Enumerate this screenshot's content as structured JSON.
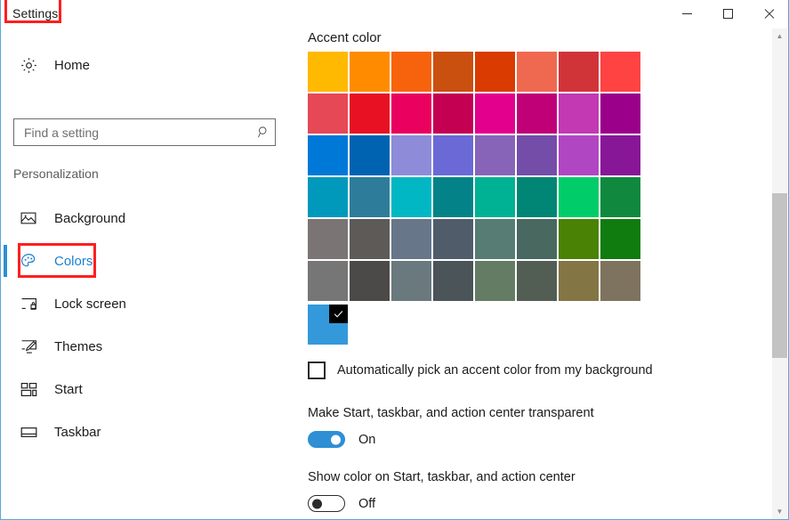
{
  "window": {
    "title": "Settings",
    "controls": {
      "minimize": "minimize-icon",
      "maximize": "maximize-icon",
      "close": "close-icon"
    },
    "border_color": "#5ba7d8",
    "highlight_color": "#fe1f1f"
  },
  "sidebar": {
    "home": {
      "label": "Home",
      "icon": "gear-icon"
    },
    "search": {
      "placeholder": "Find a setting",
      "value": "",
      "icon": "search-icon"
    },
    "section_label": "Personalization",
    "accent_bar_color": "#2e8fd4",
    "selected_item": "Colors",
    "items": [
      {
        "label": "Background",
        "icon": "image-icon"
      },
      {
        "label": "Colors",
        "icon": "palette-icon"
      },
      {
        "label": "Lock screen",
        "icon": "lock-screen-icon"
      },
      {
        "label": "Themes",
        "icon": "themes-brush-icon"
      },
      {
        "label": "Start",
        "icon": "start-tiles-icon"
      },
      {
        "label": "Taskbar",
        "icon": "taskbar-icon"
      }
    ]
  },
  "main": {
    "accent_heading": "Accent color",
    "swatch_rows": [
      [
        "#ffb900",
        "#ff8c00",
        "#f7630c",
        "#ca5010",
        "#da3b01",
        "#ef6950",
        "#d13438",
        "#ff4343"
      ],
      [
        "#e74856",
        "#e81123",
        "#ea005e",
        "#c30052",
        "#e3008c",
        "#bf0077",
        "#c239b3",
        "#9a0089"
      ],
      [
        "#0078d7",
        "#0063b1",
        "#8e8cd8",
        "#6b69d6",
        "#8764b8",
        "#744da9",
        "#b146c2",
        "#881798"
      ],
      [
        "#0099bc",
        "#2d7d9a",
        "#00b7c3",
        "#038387",
        "#00b294",
        "#018574",
        "#00cc6a",
        "#10893e"
      ],
      [
        "#7a7574",
        "#5d5a58",
        "#68768a",
        "#515c6b",
        "#567c73",
        "#486860",
        "#498205",
        "#107c10"
      ],
      [
        "#767676",
        "#4c4a48",
        "#69797e",
        "#4a5459",
        "#647c64",
        "#525e54",
        "#847545",
        "#7e735f"
      ]
    ],
    "selected_swatch": {
      "color": "#3399db",
      "corner_color": "#000000",
      "check_icon": "check-icon",
      "checked": true
    },
    "auto_accent": {
      "label": "Automatically pick an accent color from my background",
      "checked": false
    },
    "settings": [
      {
        "title": "Make Start, taskbar, and action center transparent",
        "state_label": "On",
        "on": true
      },
      {
        "title": "Show color on Start, taskbar, and action center",
        "state_label": "Off",
        "on": false
      }
    ]
  },
  "scrollbar": {
    "up_icon": "chevron-up-icon",
    "down_icon": "chevron-down-icon",
    "thumb_color": "#c3c3c3"
  }
}
